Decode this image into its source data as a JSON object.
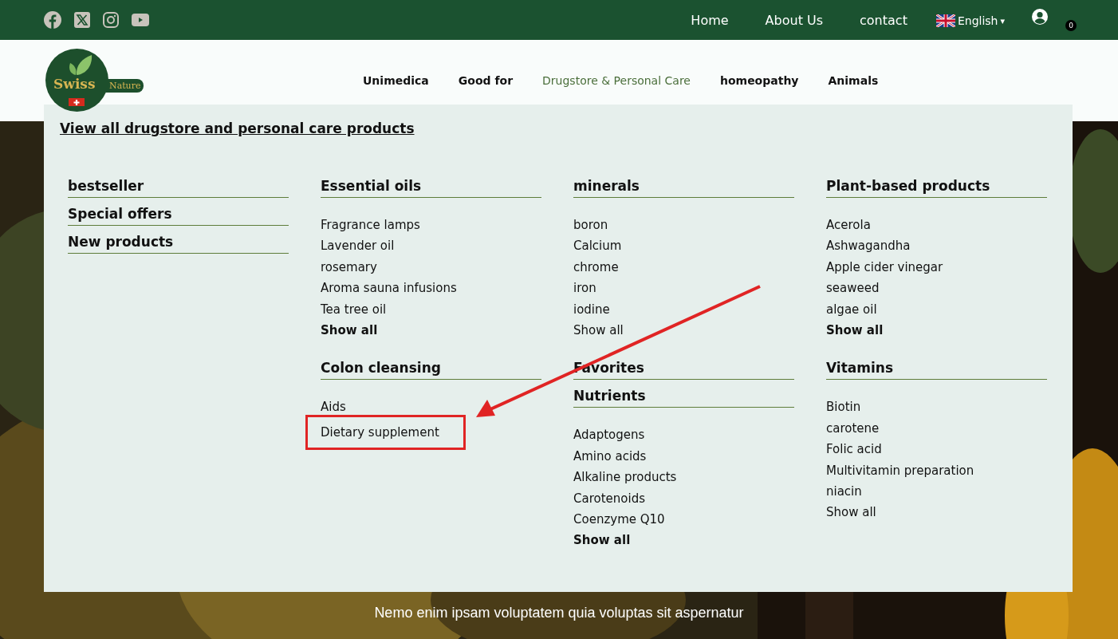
{
  "topbar": {
    "links": [
      "Home",
      "About Us",
      "contact"
    ],
    "language": "English",
    "language_caret": "▾",
    "cart_count": "0"
  },
  "logo": {
    "name": "Swiss",
    "tagline": "Nature"
  },
  "nav": [
    {
      "label": "Unimedica",
      "selected": false
    },
    {
      "label": "Good for",
      "selected": false
    },
    {
      "label": "Drugstore & Personal Care",
      "selected": true
    },
    {
      "label": "homeopathy",
      "selected": false
    },
    {
      "label": "Animals",
      "selected": false
    }
  ],
  "dropdown": {
    "view_all": "View all drugstore and personal care products",
    "columns": [
      [
        {
          "title": "bestseller"
        },
        {
          "title": "Special offers"
        },
        {
          "title": "New products"
        }
      ],
      [
        {
          "title": "Essential oils",
          "items": [
            {
              "label": "Fragrance lamps",
              "strong": false,
              "highlighted": false
            },
            {
              "label": "Lavender oil",
              "strong": false,
              "highlighted": false
            },
            {
              "label": "rosemary",
              "strong": false,
              "highlighted": false
            },
            {
              "label": "Aroma sauna infusions",
              "strong": false,
              "highlighted": false
            },
            {
              "label": "Tea tree oil",
              "strong": false,
              "highlighted": false
            },
            {
              "label": "Show all",
              "strong": true,
              "highlighted": false
            }
          ]
        },
        {
          "title": "Colon cleansing",
          "items": [
            {
              "label": "Aids",
              "strong": false,
              "highlighted": false
            },
            {
              "label": "Dietary supplement",
              "strong": false,
              "highlighted": true
            }
          ]
        }
      ],
      [
        {
          "title": "minerals",
          "items": [
            {
              "label": "boron",
              "strong": false,
              "highlighted": false
            },
            {
              "label": "Calcium",
              "strong": false,
              "highlighted": false
            },
            {
              "label": "chrome",
              "strong": false,
              "highlighted": false
            },
            {
              "label": "iron",
              "strong": false,
              "highlighted": false
            },
            {
              "label": "iodine",
              "strong": false,
              "highlighted": false
            },
            {
              "label": "Show all",
              "strong": false,
              "highlighted": false
            }
          ]
        },
        {
          "title": "Favorites"
        },
        {
          "title": "Nutrients",
          "items": [
            {
              "label": "Adaptogens",
              "strong": false,
              "highlighted": false
            },
            {
              "label": "Amino acids",
              "strong": false,
              "highlighted": false
            },
            {
              "label": "Alkaline products",
              "strong": false,
              "highlighted": false
            },
            {
              "label": "Carotenoids",
              "strong": false,
              "highlighted": false
            },
            {
              "label": "Coenzyme Q10",
              "strong": false,
              "highlighted": false
            },
            {
              "label": "Show all",
              "strong": true,
              "highlighted": false
            }
          ]
        }
      ],
      [
        {
          "title": "Plant-based products",
          "items": [
            {
              "label": "Acerola",
              "strong": false,
              "highlighted": false
            },
            {
              "label": "Ashwagandha",
              "strong": false,
              "highlighted": false
            },
            {
              "label": "Apple cider vinegar",
              "strong": false,
              "highlighted": false
            },
            {
              "label": "seaweed",
              "strong": false,
              "highlighted": false
            },
            {
              "label": "algae oil",
              "strong": false,
              "highlighted": false
            },
            {
              "label": "Show all",
              "strong": true,
              "highlighted": false
            }
          ]
        },
        {
          "title": "Vitamins",
          "items": [
            {
              "label": "Biotin",
              "strong": false,
              "highlighted": false
            },
            {
              "label": "carotene",
              "strong": false,
              "highlighted": false
            },
            {
              "label": "Folic acid",
              "strong": false,
              "highlighted": false
            },
            {
              "label": "Multivitamin preparation",
              "strong": false,
              "highlighted": false
            },
            {
              "label": "niacin",
              "strong": false,
              "highlighted": false
            },
            {
              "label": "Show all",
              "strong": false,
              "highlighted": false
            }
          ]
        }
      ]
    ]
  },
  "hero": {
    "text": "Nemo enim ipsam voluptatem quia voluptas sit aspernatur"
  }
}
